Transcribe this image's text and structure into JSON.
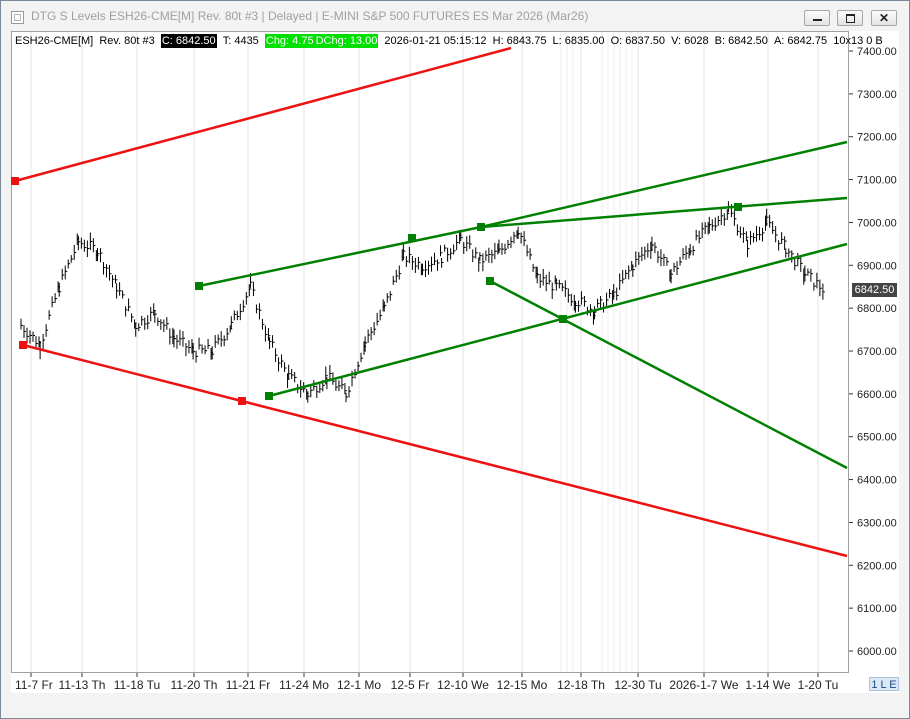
{
  "window": {
    "title": "DTG S Levels ESH26-CME[M]  Rev. 80t #3 | Delayed | E-MINI S&P 500 FUTURES ES Mar 2026 (Mar26)",
    "close_glyph": "✕"
  },
  "infobar": {
    "symbol": "ESH26-CME[M]",
    "bar_type": "Rev. 80t #3",
    "close": "C: 6842.50",
    "ticks": "T: 4435",
    "chg": "Chg: 4.75",
    "dchg": "DChg: 13.00",
    "datetime": "2026-01-21 05:15:12",
    "high": "H: 6843.75",
    "low": "L: 6835.00",
    "open": "O: 6837.50",
    "volume": "V: 6028",
    "bid": "B: 6842.50",
    "ask": "A: 6842.75",
    "tail": "10x13 0 B"
  },
  "last_price_label": "6842.50",
  "le_label": "1 L E",
  "colors": {
    "price_bars": "#000000",
    "green_lines": "#008000",
    "red_lines": "#ee1111",
    "grid": "#e3e3e3",
    "last_price_bg": "#444444",
    "change_bg": "#00e000"
  },
  "chart_data": {
    "type": "bar",
    "subtype": "price bars (OHLC reversal bars)",
    "ylim": [
      5950,
      7450
    ],
    "y_ticks": [
      6000,
      6100,
      6200,
      6300,
      6400,
      6500,
      6600,
      6700,
      6800,
      6900,
      7000,
      7100,
      7200,
      7300,
      7400
    ],
    "y_tick_labels": [
      "6000.00",
      "6100.00",
      "6200.00",
      "6300.00",
      "6400.00",
      "6500.00",
      "6600.00",
      "6700.00",
      "6800.00",
      "6900.00",
      "7000.00",
      "7100.00",
      "7200.00",
      "7300.00",
      "7400.00"
    ],
    "x_tick_labels": [
      "11-7 Fr",
      "11-13 Th",
      "11-18 Tu",
      "11-20 Th",
      "11-21 Fr",
      "11-24 Mo",
      "12-1 Mo",
      "12-5 Fr",
      "12-10 We",
      "12-15 Mo",
      "12-18 Th",
      "12-30 Tu",
      "2026-1-7 We",
      "1-14 We",
      "1-20 Tu"
    ],
    "grid": "vertical session lines",
    "last_price": 6842.5,
    "close_path": [
      {
        "x": "11-7 Fr",
        "y": 6760
      },
      {
        "x": "11-7",
        "y": 6715
      },
      {
        "x": "11-10",
        "y": 6850
      },
      {
        "x": "11-11",
        "y": 6955
      },
      {
        "x": "11-12",
        "y": 6935
      },
      {
        "x": "11-13 Th",
        "y": 6850
      },
      {
        "x": "11-13",
        "y": 6760
      },
      {
        "x": "11-14",
        "y": 6790
      },
      {
        "x": "11-17",
        "y": 6730
      },
      {
        "x": "11-18 Tu",
        "y": 6700
      },
      {
        "x": "11-19",
        "y": 6700
      },
      {
        "x": "11-20 Th",
        "y": 6760
      },
      {
        "x": "11-20",
        "y": 6850
      },
      {
        "x": "11-20",
        "y": 6720
      },
      {
        "x": "11-21 Fr",
        "y": 6640
      },
      {
        "x": "11-21",
        "y": 6600
      },
      {
        "x": "11-21",
        "y": 6640
      },
      {
        "x": "11-24 Mo",
        "y": 6600
      },
      {
        "x": "11-25",
        "y": 6720
      },
      {
        "x": "11-26",
        "y": 6800
      },
      {
        "x": "11-28",
        "y": 6920
      },
      {
        "x": "12-1 Mo",
        "y": 6900
      },
      {
        "x": "12-3",
        "y": 6920
      },
      {
        "x": "12-5 Fr",
        "y": 6960
      },
      {
        "x": "12-8",
        "y": 6910
      },
      {
        "x": "12-10 We",
        "y": 6930
      },
      {
        "x": "12-11",
        "y": 6985
      },
      {
        "x": "12-12",
        "y": 6870
      },
      {
        "x": "12-15 Mo",
        "y": 6850
      },
      {
        "x": "12-17",
        "y": 6820
      },
      {
        "x": "12-18 Th",
        "y": 6795
      },
      {
        "x": "12-19",
        "y": 6830
      },
      {
        "x": "12-22",
        "y": 6900
      },
      {
        "x": "12-30 Tu",
        "y": 6950
      },
      {
        "x": "1-2",
        "y": 6880
      },
      {
        "x": "1-5",
        "y": 6940
      },
      {
        "x": "2026-1-7 We",
        "y": 6990
      },
      {
        "x": "1-8",
        "y": 7030
      },
      {
        "x": "1-12",
        "y": 6950
      },
      {
        "x": "1-14 We",
        "y": 7000
      },
      {
        "x": "1-16",
        "y": 6940
      },
      {
        "x": "1-20 Tu",
        "y": 6880
      },
      {
        "x": "1-21",
        "y": 6842.5
      }
    ],
    "trendlines": [
      {
        "color": "green",
        "from": {
          "x": "11-20 Th",
          "y": 6850
        },
        "to": {
          "x": "12-11",
          "y": 6985
        }
      },
      {
        "color": "green",
        "from": {
          "x": "12-11",
          "y": 6985
        },
        "to": {
          "x": "1-21",
          "y": 7185
        }
      },
      {
        "color": "green",
        "from": {
          "x": "12-11",
          "y": 6985
        },
        "to": {
          "x": "1-21",
          "y": 7055
        }
      },
      {
        "color": "green",
        "from": {
          "x": "11-24 Mo",
          "y": 6595
        },
        "to": {
          "x": "1-21",
          "y": 6945
        }
      },
      {
        "color": "green",
        "from": {
          "x": "12-11",
          "y": 6860
        },
        "to": {
          "x": "1-21",
          "y": 6430
        }
      },
      {
        "color": "red",
        "from": {
          "x": "11-7 Fr",
          "y": 7095
        },
        "to": {
          "x": "12-12",
          "y": 7400
        }
      },
      {
        "color": "red",
        "from": {
          "x": "11-7",
          "y": 6715
        },
        "to": {
          "x": "1-21",
          "y": 6225
        }
      }
    ]
  }
}
